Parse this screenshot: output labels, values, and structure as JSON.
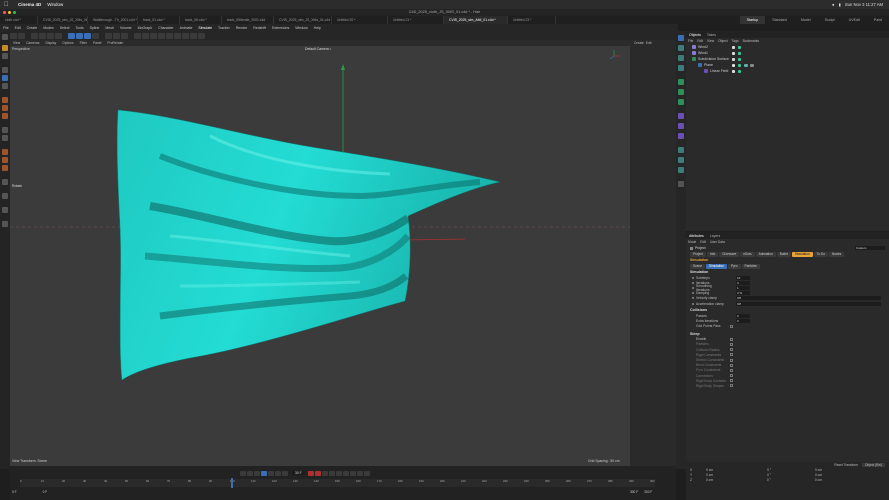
{
  "mac_menu": {
    "app": "Cinema 4D",
    "window": "Window",
    "clock": "Sun Nov 3  11:27 AM"
  },
  "window_title": "C4D_2025_cloth_JS_XMS_01.c4d * - Hair",
  "file_tabs": [
    "cloth.c4d *",
    "CVIS_2025_sim_JS_XMs_01.c4d",
    "Walkthrough...Th_2001.c4d *",
    "track_01.c4d *",
    "track_06.c4d *",
    "track_05Iterdie_2001.c4d",
    "CVIS_2025_sim_JS_XMs_01.c4d *",
    "Untitled 20 *",
    "Untitled 21 *",
    "CVIS_2025_sim_AMI_01.c4d *",
    "Untitled 23 *"
  ],
  "layout_tabs": [
    "Startup",
    "Standard",
    "Model",
    "Sculpt",
    "UVEdit",
    "Paint"
  ],
  "active_layout": "Startup",
  "app_menu": [
    "File",
    "Edit",
    "Create",
    "Modes",
    "Select",
    "Tools",
    "Spline",
    "Mesh",
    "Volume",
    "MoGraph",
    "Character",
    "Animate",
    "Simulate",
    "Tracker",
    "Render",
    "Redshift",
    "Extensions",
    "Window",
    "Help"
  ],
  "viewport_menu": [
    "View",
    "Cameras",
    "Display",
    "Options",
    "Filter",
    "Panel",
    "ProRender"
  ],
  "viewport": {
    "projection": "Perspective",
    "camera": "Default Camera •",
    "hint": "Rotate",
    "footer_left": "View Transform: Scene",
    "footer_right": "Grid Spacing : 50 cm",
    "cloth_color": "#21d4cc",
    "bg_color": "#3b3b3b"
  },
  "objects_panel": {
    "tabs": [
      "Objects",
      "Takes"
    ],
    "menu": [
      "File",
      "Edit",
      "View",
      "Object",
      "Tags",
      "Bookmarks"
    ],
    "rows": [
      {
        "name": "Wind2",
        "indent": 0
      },
      {
        "name": "Wind1",
        "indent": 0
      },
      {
        "name": "Subdivision Surface",
        "indent": 0
      },
      {
        "name": "Plane",
        "indent": 1
      },
      {
        "name": "Linear Field",
        "indent": 2
      }
    ]
  },
  "attributes_panel": {
    "tabs": [
      "Attributes",
      "Layers"
    ],
    "menu": [
      "Mode",
      "Edit",
      "User Data"
    ],
    "object_label": "Project",
    "dropdown": "Custom",
    "top_tabs": [
      "Project",
      "Info",
      "Cinewave",
      "nDots",
      "Animation",
      "Bullet",
      "Simulation",
      "To Do",
      "Nodes"
    ],
    "active_top_tab": "Simulation",
    "section": "Simulation",
    "sub_tabs": [
      "Scene",
      "Simulation",
      "Pyro",
      "Particles"
    ],
    "active_sub_tab": "Simulation",
    "sim_header": "Simulation",
    "params": [
      {
        "label": "Substeps",
        "value": "10"
      },
      {
        "label": "Iterations",
        "value": "3"
      },
      {
        "label": "Smoothing Iterations",
        "value": "1"
      },
      {
        "label": "Damping",
        "value": "3 %"
      },
      {
        "label": "Velocity clamp",
        "value": "Off"
      },
      {
        "label": "Acceleration clamp",
        "value": "Off"
      }
    ],
    "collisions_header": "Collisions",
    "collision_params": [
      {
        "label": "Passes",
        "value": "2"
      },
      {
        "label": "Extra Iterations",
        "value": "0"
      },
      {
        "label": "Grid Points Pass",
        "value": ""
      }
    ],
    "sleep_header": "Sleep",
    "sleep_params": [
      "Enable",
      "Particles",
      "Collision Radius",
      "Rigid Constraints",
      "Stretch Constraints",
      "Bend Constraints",
      "Pyro Constraints",
      "Connectors",
      "Rigid Body Contacts",
      "Rigid Body Shapes"
    ]
  },
  "coords": {
    "tabs": [
      "Reset Transform",
      "Object (Rel)"
    ],
    "rows": [
      {
        "axis": "X",
        "pos": "0 cm",
        "rot": "0 °",
        "scale": "0 cm"
      },
      {
        "axis": "Y",
        "pos": "0 cm",
        "rot": "0 °",
        "scale": "0 cm"
      },
      {
        "axis": "Z",
        "pos": "0 cm",
        "rot": "0 °",
        "scale": "0 cm"
      }
    ]
  },
  "timeline": {
    "current_frame": "30 F",
    "start": "0 F",
    "start2": "0 F",
    "end": "300 F",
    "end2": "300 F",
    "ticks": [
      "0",
      "10",
      "20",
      "30",
      "40",
      "50",
      "60",
      "70",
      "80",
      "90",
      "100",
      "110",
      "120",
      "130",
      "140",
      "150",
      "160",
      "170",
      "180",
      "190",
      "200",
      "210",
      "220",
      "230",
      "240",
      "250",
      "260",
      "270",
      "280",
      "290",
      "300"
    ]
  }
}
